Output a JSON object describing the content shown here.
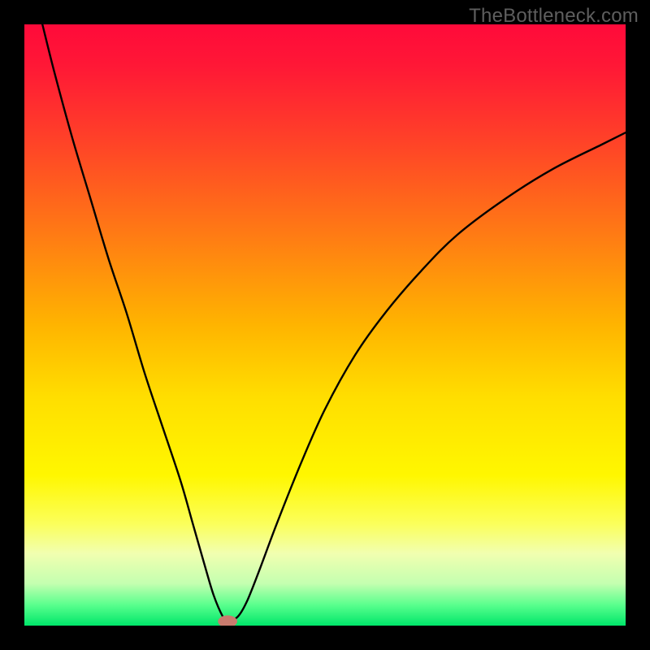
{
  "watermark": "TheBottleneck.com",
  "chart_data": {
    "type": "line",
    "title": "",
    "xlabel": "",
    "ylabel": "",
    "xlim": [
      0,
      100
    ],
    "ylim": [
      0,
      100
    ],
    "background_gradient": {
      "stops": [
        {
          "offset": 0.0,
          "color": "#ff0a3a"
        },
        {
          "offset": 0.07,
          "color": "#ff1836"
        },
        {
          "offset": 0.2,
          "color": "#ff4427"
        },
        {
          "offset": 0.35,
          "color": "#ff7b14"
        },
        {
          "offset": 0.5,
          "color": "#ffb400"
        },
        {
          "offset": 0.62,
          "color": "#ffde00"
        },
        {
          "offset": 0.75,
          "color": "#fff700"
        },
        {
          "offset": 0.83,
          "color": "#fbff5a"
        },
        {
          "offset": 0.88,
          "color": "#f1ffb0"
        },
        {
          "offset": 0.93,
          "color": "#c4ffb0"
        },
        {
          "offset": 0.965,
          "color": "#5bff8e"
        },
        {
          "offset": 1.0,
          "color": "#00e66a"
        }
      ]
    },
    "series": [
      {
        "name": "bottleneck-curve",
        "type": "line",
        "color": "#000000",
        "width": 2.4,
        "x": [
          3,
          5,
          8,
          11,
          14,
          17,
          20,
          23,
          26,
          28,
          30,
          31.5,
          33,
          33.8,
          35.5,
          37,
          39,
          42,
          46,
          50,
          55,
          60,
          66,
          72,
          80,
          88,
          96,
          100
        ],
        "y": [
          100,
          92,
          81,
          71,
          61,
          52,
          42,
          33,
          24,
          17,
          10,
          5,
          1.5,
          0.7,
          1.5,
          4,
          9,
          17,
          27,
          36,
          45,
          52,
          59,
          65,
          71,
          76,
          80,
          82
        ]
      }
    ],
    "marker": {
      "name": "optimal-point",
      "shape": "ellipse",
      "cx": 33.8,
      "cy": 0.7,
      "rx": 1.6,
      "ry": 1.0,
      "fill": "#c97b6e"
    }
  }
}
